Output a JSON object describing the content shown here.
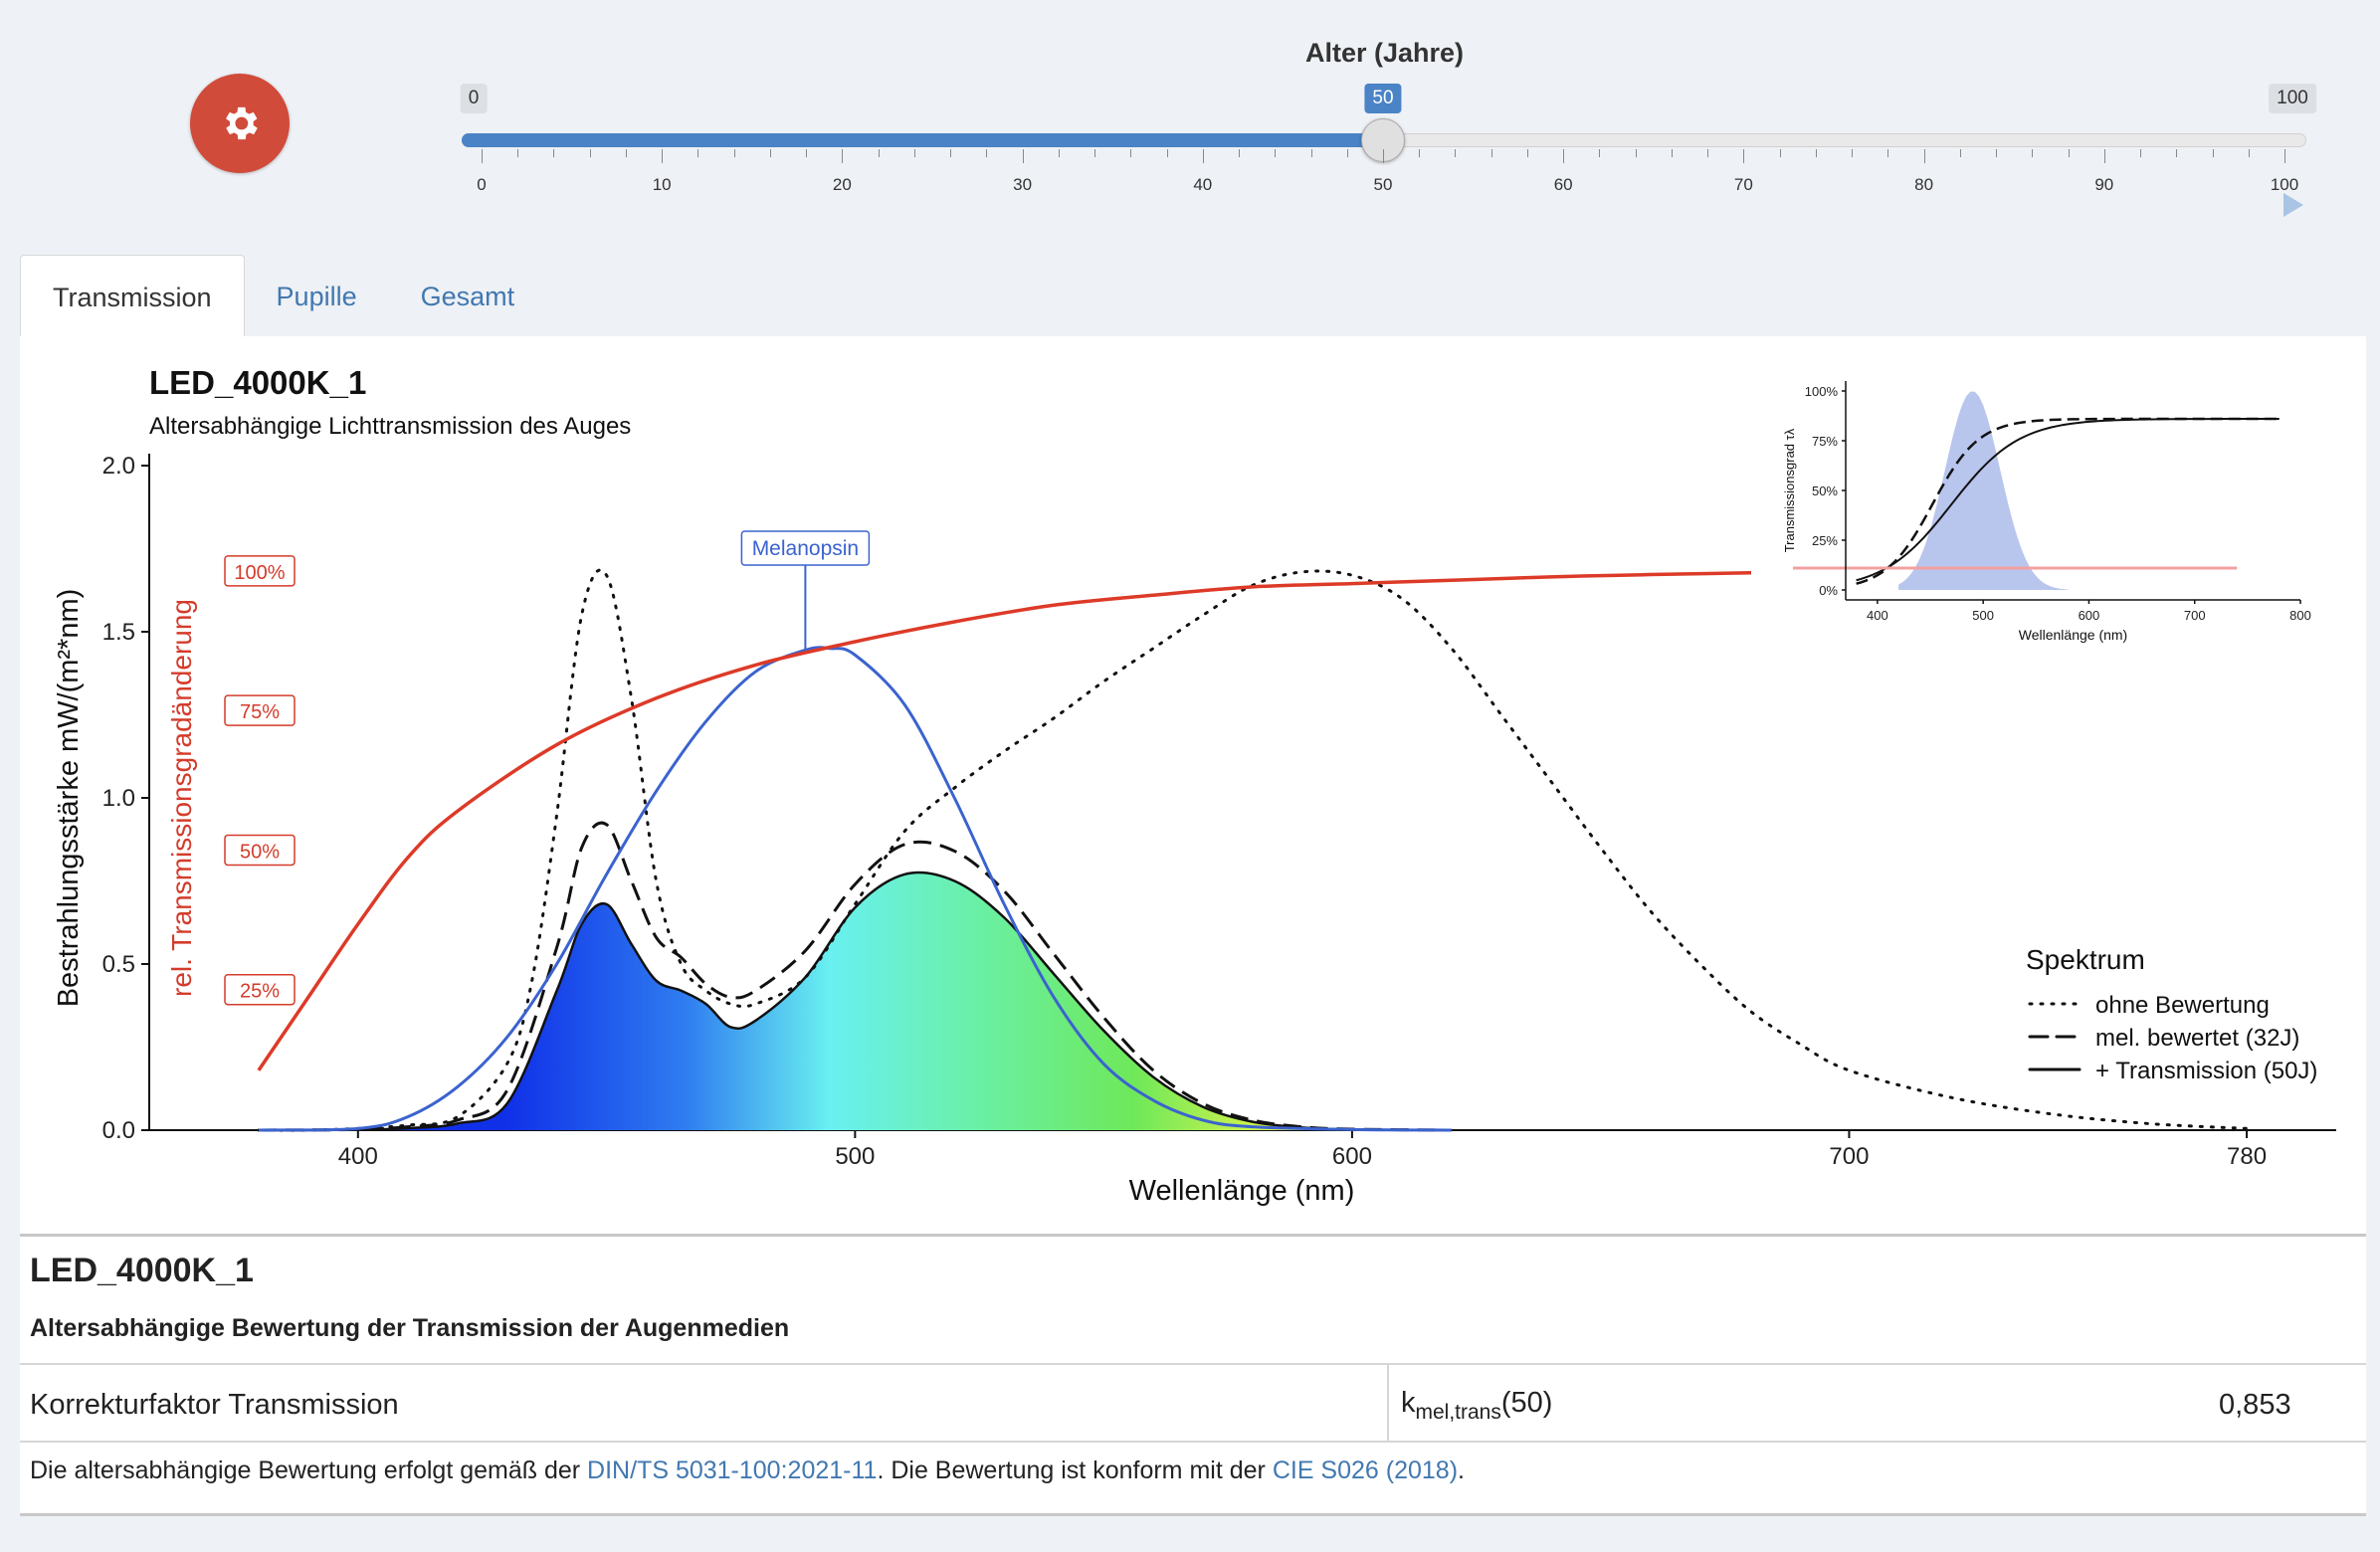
{
  "slider": {
    "title": "Alter (Jahre)",
    "min": 0,
    "max": 100,
    "value": 50,
    "min_label": "0",
    "max_label": "100",
    "value_label": "50",
    "tick_labels": [
      "0",
      "10",
      "20",
      "30",
      "40",
      "50",
      "60",
      "70",
      "80",
      "90",
      "100"
    ],
    "accent_color": "#4a83c6"
  },
  "gear": {
    "icon": "gear-icon",
    "color": "#d14b3a"
  },
  "tabs": [
    {
      "label": "Transmission",
      "active": true
    },
    {
      "label": "Pupille",
      "active": false
    },
    {
      "label": "Gesamt",
      "active": false
    }
  ],
  "chart_data": {
    "type": "line",
    "title": "LED_4000K_1",
    "subtitle": "Altersabhängige Lichttransmission des Auges",
    "xlabel": "Wellenlänge (nm)",
    "ylabel": "Bestrahlungsstärke  mW/(m²*nm)",
    "ylabel2": "rel. Transmissionsgradänderung",
    "xlim": [
      358,
      798
    ],
    "ylim": [
      0,
      2.0
    ],
    "x_ticks": [
      400,
      500,
      600,
      700,
      780
    ],
    "y_ticks": [
      "0.0",
      "0.5",
      "1.0",
      "1.5",
      "2.0"
    ],
    "y2_labels": [
      {
        "label": "100%",
        "y": 1.68
      },
      {
        "label": "75%",
        "y": 1.26
      },
      {
        "label": "50%",
        "y": 0.84
      },
      {
        "label": "25%",
        "y": 0.42
      }
    ],
    "annotation": {
      "label": "Melanopsin",
      "x": 490,
      "y": 1.445
    },
    "legend": {
      "title": "Spektrum",
      "position": "right",
      "entries": [
        "ohne Bewertung",
        "mel. bewertet (32J)",
        "+ Transmission (50J)"
      ]
    },
    "series": [
      {
        "name": "ohne Bewertung",
        "style": "dotted",
        "x": [
          380,
          390,
          400,
          410,
          420,
          430,
          435,
          440,
          445,
          450,
          455,
          460,
          465,
          470,
          475,
          480,
          490,
          500,
          510,
          520,
          530,
          540,
          550,
          560,
          570,
          580,
          590,
          600,
          610,
          620,
          630,
          640,
          650,
          660,
          670,
          680,
          690,
          700,
          720,
          740,
          760,
          780
        ],
        "values": [
          0,
          0,
          0.005,
          0.015,
          0.04,
          0.2,
          0.45,
          0.95,
          1.55,
          1.67,
          1.3,
          0.75,
          0.5,
          0.42,
          0.38,
          0.38,
          0.46,
          0.68,
          0.9,
          1.03,
          1.14,
          1.24,
          1.35,
          1.45,
          1.55,
          1.64,
          1.68,
          1.67,
          1.6,
          1.45,
          1.25,
          1.05,
          0.85,
          0.66,
          0.5,
          0.36,
          0.26,
          0.18,
          0.1,
          0.05,
          0.02,
          0.005
        ]
      },
      {
        "name": "mel. bewertet (32J)",
        "style": "dashed",
        "x": [
          380,
          400,
          410,
          420,
          430,
          440,
          445,
          450,
          455,
          460,
          465,
          470,
          475,
          480,
          490,
          500,
          510,
          520,
          530,
          540,
          550,
          560,
          570,
          580,
          590,
          600,
          620
        ],
        "values": [
          0,
          0.002,
          0.01,
          0.03,
          0.12,
          0.55,
          0.85,
          0.92,
          0.75,
          0.58,
          0.52,
          0.44,
          0.4,
          0.42,
          0.54,
          0.74,
          0.86,
          0.84,
          0.72,
          0.53,
          0.34,
          0.18,
          0.08,
          0.03,
          0.01,
          0.003,
          0
        ]
      },
      {
        "name": "+ Transmission (50J)",
        "style": "solid-filled",
        "x": [
          380,
          400,
          410,
          420,
          430,
          440,
          445,
          450,
          455,
          460,
          465,
          470,
          475,
          480,
          490,
          500,
          510,
          520,
          530,
          540,
          550,
          560,
          570,
          580,
          590,
          600,
          620
        ],
        "values": [
          0,
          0.001,
          0.006,
          0.02,
          0.08,
          0.42,
          0.62,
          0.68,
          0.56,
          0.45,
          0.42,
          0.38,
          0.31,
          0.33,
          0.46,
          0.67,
          0.77,
          0.75,
          0.64,
          0.47,
          0.3,
          0.16,
          0.07,
          0.025,
          0.008,
          0.002,
          0
        ]
      },
      {
        "name": "Melanopsin",
        "style": "blue",
        "x": [
          380,
          400,
          410,
          420,
          430,
          440,
          450,
          460,
          470,
          480,
          490,
          495,
          500,
          510,
          520,
          530,
          540,
          550,
          560,
          570,
          580,
          600,
          620
        ],
        "values": [
          0,
          0.005,
          0.04,
          0.13,
          0.28,
          0.5,
          0.77,
          1.02,
          1.23,
          1.38,
          1.445,
          1.45,
          1.43,
          1.28,
          1.0,
          0.68,
          0.4,
          0.2,
          0.09,
          0.03,
          0.01,
          0.002,
          0
        ]
      },
      {
        "name": "rel. Transmissionsgradänderung",
        "style": "red",
        "x": [
          380,
          390,
          400,
          410,
          420,
          440,
          460,
          480,
          500,
          520,
          540,
          560,
          580,
          600,
          620,
          640,
          660,
          690
        ],
        "values": [
          0.18,
          0.4,
          0.62,
          0.82,
          0.96,
          1.16,
          1.3,
          1.4,
          1.47,
          1.53,
          1.58,
          1.61,
          1.635,
          1.645,
          1.655,
          1.665,
          1.672,
          1.68
        ]
      }
    ],
    "inset": {
      "xlabel": "Wellenlänge (nm)",
      "ylabel": "Transmissionsgrad τλ",
      "x_ticks": [
        "400",
        "500",
        "600",
        "700",
        "800"
      ],
      "y_ticks": [
        "0%",
        "25%",
        "50%",
        "75%",
        "100%"
      ]
    }
  },
  "info": {
    "title": "LED_4000K_1",
    "subtitle": "Altersabhängige Bewertung der Transmission der Augenmedien",
    "row_label": "Korrekturfaktor Transmission",
    "symbol_base": "k",
    "symbol_sub": "mel,trans",
    "symbol_arg": "(50)",
    "value": "0,853",
    "footnote_pre": "Die altersabhängige Bewertung erfolgt gemäß der ",
    "link1": "DIN/TS 5031-100:2021-11",
    "footnote_mid": ". Die Bewertung ist konform mit der ",
    "link2": "CIE S026 (2018)",
    "footnote_post": "."
  }
}
